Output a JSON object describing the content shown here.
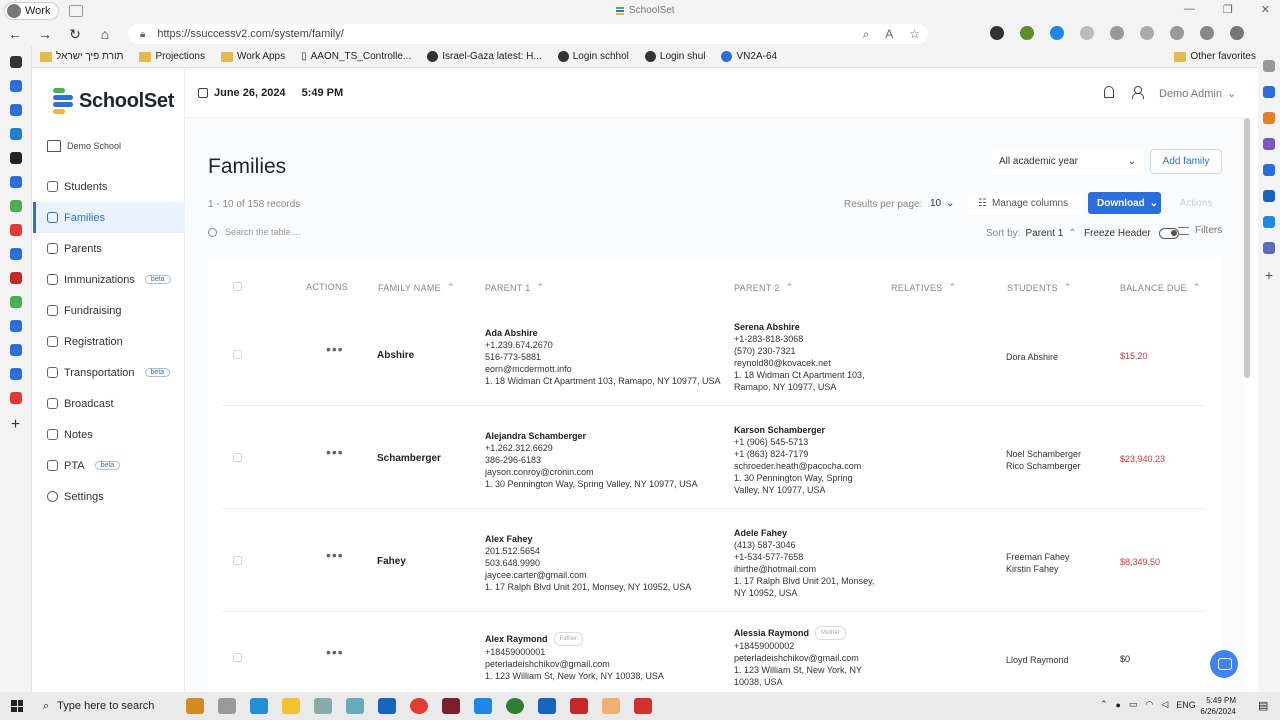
{
  "browser": {
    "profile": "Work",
    "window_title": "SchoolSet",
    "url": "https://ssuccessv2.com/system/family/",
    "bookmarks": [
      "תורת פיך ישראל",
      "Projections",
      "Work Apps",
      "AAON_TS_Controlle...",
      "Israel-Gaza latest: H...",
      "Login schhol",
      "Login shul",
      "VN2A-64"
    ],
    "other_favorites": "Other favorites"
  },
  "app": {
    "brand": "SchoolSet",
    "school": "Demo School",
    "date": "June 26, 2024",
    "time": "5:49 PM",
    "user": "Demo Admin"
  },
  "nav": [
    {
      "label": "Students",
      "icon": "students-icon",
      "beta": ""
    },
    {
      "label": "Families",
      "icon": "families-icon",
      "beta": "",
      "active": true
    },
    {
      "label": "Parents",
      "icon": "parents-icon",
      "beta": ""
    },
    {
      "label": "Immunizations",
      "icon": "syringe-icon",
      "beta": "beta"
    },
    {
      "label": "Fundraising",
      "icon": "fundraising-icon",
      "beta": ""
    },
    {
      "label": "Registration",
      "icon": "registration-icon",
      "beta": ""
    },
    {
      "label": "Transportation",
      "icon": "bus-icon",
      "beta": "beta"
    },
    {
      "label": "Broadcast",
      "icon": "broadcast-icon",
      "beta": ""
    },
    {
      "label": "Notes",
      "icon": "notes-icon",
      "beta": ""
    },
    {
      "label": "PTA",
      "icon": "pta-icon",
      "beta": "beta"
    },
    {
      "label": "Settings",
      "icon": "gear-icon",
      "beta": ""
    }
  ],
  "page": {
    "title": "Families",
    "year_filter": "All academic year",
    "add_family": "Add family",
    "records": "1 - 10 of 158 records",
    "results_per_page_label": "Results per page:",
    "results_per_page": "10",
    "manage_columns": "Manage columns",
    "download": "Download",
    "actions": "Actions",
    "search_placeholder": "Search the table ...",
    "sort_label": "Sort by:",
    "sort_value": "Parent 1",
    "freeze_header": "Freeze Header",
    "filters": "Filters"
  },
  "table": {
    "headers": {
      "actions": "ACTIONS",
      "family_name": "FAMILY NAME",
      "parent1": "PARENT 1",
      "parent2": "PARENT 2",
      "relatives": "RELATIVES",
      "students": "STUDENTS",
      "balance_due": "BALANCE DUE"
    },
    "rows": [
      {
        "family": "Abshire",
        "p1": {
          "name": "Ada Abshire",
          "tag": "",
          "lines": [
            "+1.239.674.2670",
            "516-773-5881",
            "eorn@mcdermott.info",
            "1. 18 Widman Ct Apartment 103, Ramapo, NY 10977, USA"
          ]
        },
        "p2": {
          "name": "Serena Abshire",
          "tag": "",
          "lines": [
            "+1-283-818-3068",
            "(570) 230-7321",
            "reynold80@kovacek.net",
            "1. 18 Widman Ct Apartment 103,",
            "Ramapo, NY 10977, USA"
          ]
        },
        "students": [
          "Dora Abshire"
        ],
        "balance": "$15.20",
        "owed": true
      },
      {
        "family": "Schamberger",
        "p1": {
          "name": "Alejandra Schamberger",
          "tag": "",
          "lines": [
            "+1.262.312.6629",
            "386-296-6183",
            "jayson.conroy@cronin.com",
            "1. 30 Pennington Way, Spring Valley, NY 10977, USA"
          ]
        },
        "p2": {
          "name": "Karson Schamberger",
          "tag": "",
          "lines": [
            "+1 (906) 545-5713",
            "+1 (863) 824-7179",
            "schroeder.heath@pacocha.com",
            "1. 30 Pennington Way, Spring",
            "Valley, NY 10977, USA"
          ]
        },
        "students": [
          "Noel Schamberger",
          "Rico Schamberger"
        ],
        "balance": "$23,940.23",
        "owed": true
      },
      {
        "family": "Fahey",
        "p1": {
          "name": "Alex Fahey",
          "tag": "",
          "lines": [
            "201.512.5654",
            "503.648.9990",
            "jaycee.carter@gmail.com",
            "1. 17 Ralph Blvd Unit 201, Monsey, NY 10952, USA"
          ]
        },
        "p2": {
          "name": "Adele Fahey",
          "tag": "",
          "lines": [
            "(413) 587-3046",
            "+1-534-577-7658",
            "ihirthe@hotmail.com",
            "1. 17 Ralph Blvd Unit 201, Monsey,",
            "NY 10952, USA"
          ]
        },
        "students": [
          "Freeman Fahey",
          "Kirstin Fahey"
        ],
        "balance": "$8,349.50",
        "owed": true
      },
      {
        "family": "",
        "p1": {
          "name": "Alex Raymond",
          "tag": "Father",
          "lines": [
            "+18459000001",
            "peterladeishchikov@gmail.com",
            "1. 123 William St, New York, NY 10038, USA"
          ]
        },
        "p2": {
          "name": "Alessia Raymond",
          "tag": "Mother",
          "lines": [
            "+18459000002",
            "peterladeishchikov@gmail.com",
            "1. 123 William St, New York, NY",
            "10038, USA"
          ]
        },
        "students": [
          "Lloyd Raymond"
        ],
        "balance": "$0",
        "owed": false
      }
    ]
  },
  "taskbar": {
    "search_placeholder": "Type here to search",
    "language": "ENG",
    "time": "5:49 PM",
    "date": "6/26/2024"
  },
  "colors": {
    "accent": "#2a6fdb",
    "owed": "#d33a3a"
  }
}
